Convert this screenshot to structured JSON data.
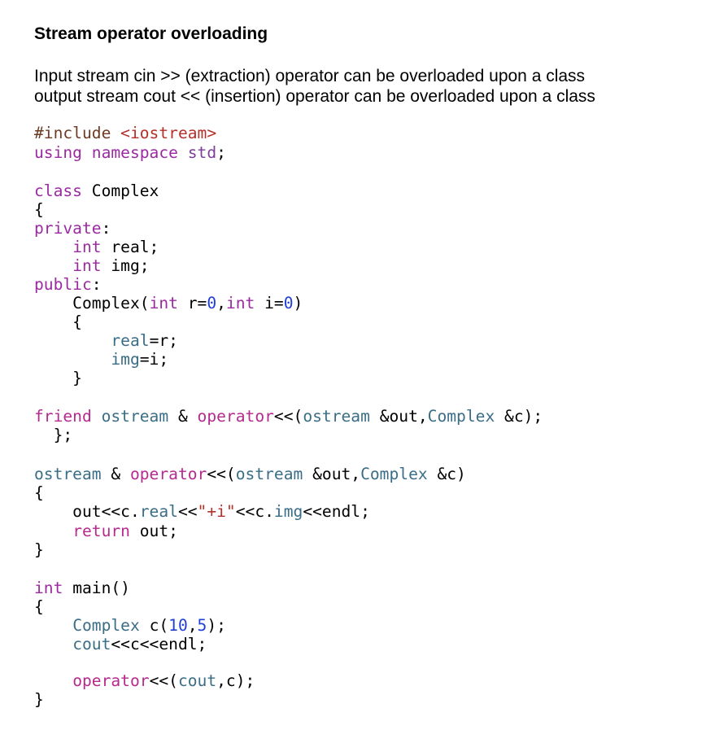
{
  "heading": "Stream operator overloading",
  "description": [
    "Input stream cin >> (extraction) operator can be overloaded upon a class",
    "output stream cout << (insertion) operator can be overloaded upon a class"
  ],
  "colors": {
    "preprocessor": "#6b3b23",
    "string": "#b5302a",
    "keyword": "#9b2aa1",
    "type": "#7e3e9a",
    "function": "#b52a8e",
    "class_name": "#3a6d86",
    "number": "#1f3fd6"
  },
  "code_lines": [
    [
      [
        "pp",
        "#include "
      ],
      [
        "str",
        "<iostream>"
      ]
    ],
    [
      [
        "kw",
        "using namespace "
      ],
      [
        "typ",
        "std"
      ],
      [
        "pl",
        ";"
      ]
    ],
    [],
    [
      [
        "kw",
        "class "
      ],
      [
        "pl",
        "Complex"
      ]
    ],
    [
      [
        "pl",
        "{"
      ]
    ],
    [
      [
        "kw",
        "private"
      ],
      [
        "pl",
        ":"
      ]
    ],
    [
      [
        "pl",
        "    "
      ],
      [
        "kw",
        "int "
      ],
      [
        "pl",
        "real;"
      ]
    ],
    [
      [
        "pl",
        "    "
      ],
      [
        "kw",
        "int "
      ],
      [
        "pl",
        "img;"
      ]
    ],
    [
      [
        "kw",
        "public"
      ],
      [
        "pl",
        ":"
      ]
    ],
    [
      [
        "pl",
        "    Complex("
      ],
      [
        "kw",
        "int "
      ],
      [
        "pl",
        "r="
      ],
      [
        "num",
        "0"
      ],
      [
        "pl",
        ","
      ],
      [
        "kw",
        "int "
      ],
      [
        "pl",
        "i="
      ],
      [
        "num",
        "0"
      ],
      [
        "pl",
        ")"
      ]
    ],
    [
      [
        "pl",
        "    {"
      ]
    ],
    [
      [
        "pl",
        "        "
      ],
      [
        "cls",
        "real"
      ],
      [
        "pl",
        "=r;"
      ]
    ],
    [
      [
        "pl",
        "        "
      ],
      [
        "cls",
        "img"
      ],
      [
        "pl",
        "=i;"
      ]
    ],
    [
      [
        "pl",
        "    }"
      ]
    ],
    [],
    [
      [
        "fn",
        "friend "
      ],
      [
        "cls",
        "ostream "
      ],
      [
        "pl",
        "& "
      ],
      [
        "fn",
        "operator"
      ],
      [
        "pl",
        "<<("
      ],
      [
        "cls",
        "ostream "
      ],
      [
        "pl",
        "&out,"
      ],
      [
        "cls",
        "Complex "
      ],
      [
        "pl",
        "&c);"
      ]
    ],
    [
      [
        "pl",
        "  };"
      ]
    ],
    [],
    [
      [
        "cls",
        "ostream "
      ],
      [
        "pl",
        "& "
      ],
      [
        "fn",
        "operator"
      ],
      [
        "pl",
        "<<("
      ],
      [
        "cls",
        "ostream "
      ],
      [
        "pl",
        "&out,"
      ],
      [
        "cls",
        "Complex "
      ],
      [
        "pl",
        "&c)"
      ]
    ],
    [
      [
        "pl",
        "{"
      ]
    ],
    [
      [
        "pl",
        "    out<<c."
      ],
      [
        "cls",
        "real"
      ],
      [
        "pl",
        "<<"
      ],
      [
        "str",
        "\"+i\""
      ],
      [
        "pl",
        "<<c."
      ],
      [
        "cls",
        "img"
      ],
      [
        "pl",
        "<<endl;"
      ]
    ],
    [
      [
        "pl",
        "    "
      ],
      [
        "fn",
        "return "
      ],
      [
        "pl",
        "out;"
      ]
    ],
    [
      [
        "pl",
        "}"
      ]
    ],
    [],
    [
      [
        "kw",
        "int "
      ],
      [
        "pl",
        "main()"
      ]
    ],
    [
      [
        "pl",
        "{"
      ]
    ],
    [
      [
        "pl",
        "    "
      ],
      [
        "cls",
        "Complex "
      ],
      [
        "pl",
        "c("
      ],
      [
        "num",
        "10"
      ],
      [
        "pl",
        ","
      ],
      [
        "num",
        "5"
      ],
      [
        "pl",
        ");"
      ]
    ],
    [
      [
        "pl",
        "    "
      ],
      [
        "cls",
        "cout"
      ],
      [
        "pl",
        "<<c<<endl;"
      ]
    ],
    [],
    [
      [
        "pl",
        "    "
      ],
      [
        "fn",
        "operator"
      ],
      [
        "pl",
        "<<("
      ],
      [
        "cls",
        "cout"
      ],
      [
        "pl",
        ",c);"
      ]
    ],
    [
      [
        "pl",
        "}"
      ]
    ]
  ]
}
